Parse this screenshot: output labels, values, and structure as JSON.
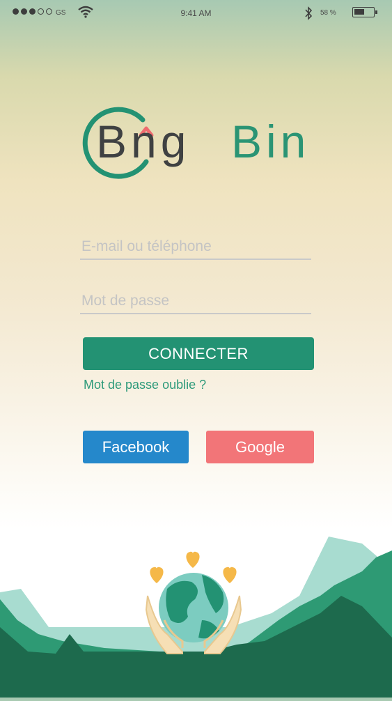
{
  "status_bar": {
    "carrier": "GS",
    "time": "9:41 AM",
    "battery_percent": "58 %",
    "battery_level": 0.58,
    "signal_bars_filled": 3,
    "signal_bars_total": 5
  },
  "logo": {
    "word1": "Bng",
    "word2": "Bin"
  },
  "login": {
    "email_placeholder": "E-mail ou téléphone",
    "email_value": "",
    "password_placeholder": "Mot de passe",
    "password_value": "",
    "connect_label": "CONNECTER",
    "forgot_label": "Mot de passe oublie ?"
  },
  "social": {
    "facebook_label": "Facebook",
    "google_label": "Google"
  },
  "colors": {
    "primary_green": "#239273",
    "facebook_blue": "#2588cb",
    "google_red": "#f27578",
    "logo_dark": "#3f4142",
    "arrow_pink": "#ee6b6f"
  },
  "icons": [
    "wifi-icon",
    "bluetooth-icon",
    "battery-icon",
    "logo-arrow-icon",
    "earth-hands-illustration",
    "heart-icon"
  ]
}
